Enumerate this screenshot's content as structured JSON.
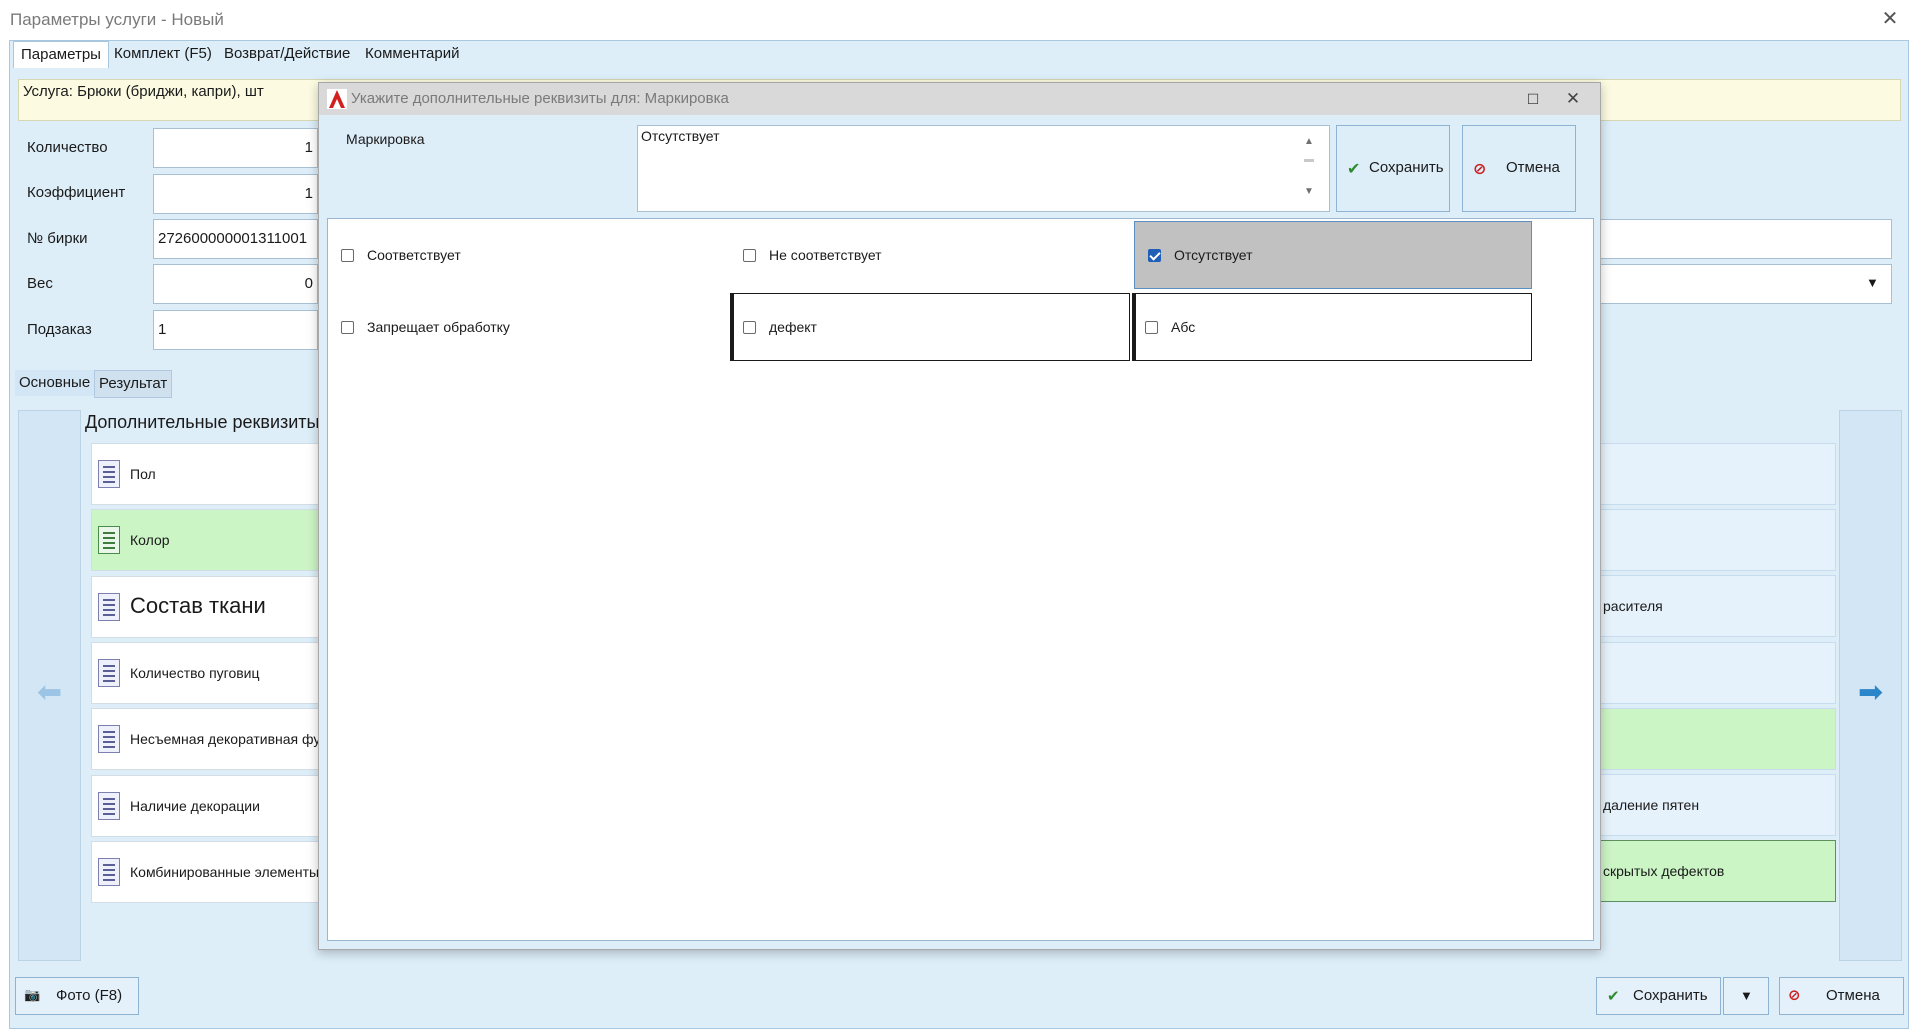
{
  "window": {
    "title": "Параметры услуги - Новый",
    "close_glyph": "✕"
  },
  "tabs": [
    {
      "label": "Параметры",
      "active": true
    },
    {
      "label": "Комплект (F5)",
      "active": false
    },
    {
      "label": "Возврат/Действие",
      "active": false
    },
    {
      "label": "Комментарий",
      "active": false
    }
  ],
  "service": {
    "text": "Услуга: Брюки (бриджи, капри), шт"
  },
  "fields": [
    {
      "label": "Количество",
      "value": "1"
    },
    {
      "label": "Коэффициент",
      "value": "1"
    },
    {
      "label": "№ бирки",
      "value": "272600000001311001"
    },
    {
      "label": "Вес",
      "value": "0"
    },
    {
      "label": "Подзаказ",
      "value": "1"
    }
  ],
  "dropdown_glyph": "▼",
  "subtabs": [
    {
      "label": "Основные",
      "active": true
    },
    {
      "label": "Результат",
      "active": false
    }
  ],
  "attributes": {
    "heading": "Дополнительные реквизиты",
    "left_items": [
      {
        "label": "Пол",
        "highlight": false
      },
      {
        "label": "Колор",
        "highlight": true
      },
      {
        "label": "Состав ткани",
        "highlight": false
      },
      {
        "label": "Количество пуговиц",
        "highlight": false
      },
      {
        "label": "Несъемная декоративная фурнитура",
        "highlight": false
      },
      {
        "label": "Наличие декорации",
        "highlight": false
      },
      {
        "label": "Комбинированные элементы",
        "highlight": false
      }
    ],
    "right_items": [
      {
        "label": "",
        "highlight": false
      },
      {
        "label": "",
        "highlight": false
      },
      {
        "label": "расителя",
        "highlight": false
      },
      {
        "label": "",
        "highlight": false
      },
      {
        "label": "",
        "highlight": true
      },
      {
        "label": "даление пятен",
        "highlight": false
      },
      {
        "label": "скрытых дефектов",
        "highlight": true
      }
    ]
  },
  "bottom": {
    "photo_label": "Фото (F8)",
    "photo_icon": "📷",
    "save_label": "Сохранить",
    "save_icon": "✔",
    "split_glyph": "▼",
    "cancel_label": "Отмена",
    "cancel_icon": "⊘"
  },
  "dialog": {
    "title": "Укажите дополнительные реквизиты для: Маркировка",
    "logo_letter": "A",
    "max_glyph": "☐",
    "close_glyph": "✕",
    "field_label": "Маркировка",
    "memo_value": "Отсутствует",
    "save_label": "Сохранить",
    "save_icon": "✔",
    "cancel_label": "Отмена",
    "cancel_icon": "⊘",
    "options": [
      {
        "label": "Соответствует",
        "checked": false
      },
      {
        "label": "Не соответствует",
        "checked": false
      },
      {
        "label": "Отсутствует",
        "checked": true
      },
      {
        "label": "Запрещает обработку",
        "checked": false
      },
      {
        "label": "дефект",
        "checked": false
      },
      {
        "label": "Абс",
        "checked": false
      }
    ]
  },
  "colors": {
    "accent_blue": "#2a86c8",
    "panel_bg": "#ddeef9",
    "highlight_green": "#ccf5c6",
    "selected_gray": "#c1c1c1",
    "save_green": "#2e8b2e",
    "cancel_red": "#cc1f1f"
  }
}
